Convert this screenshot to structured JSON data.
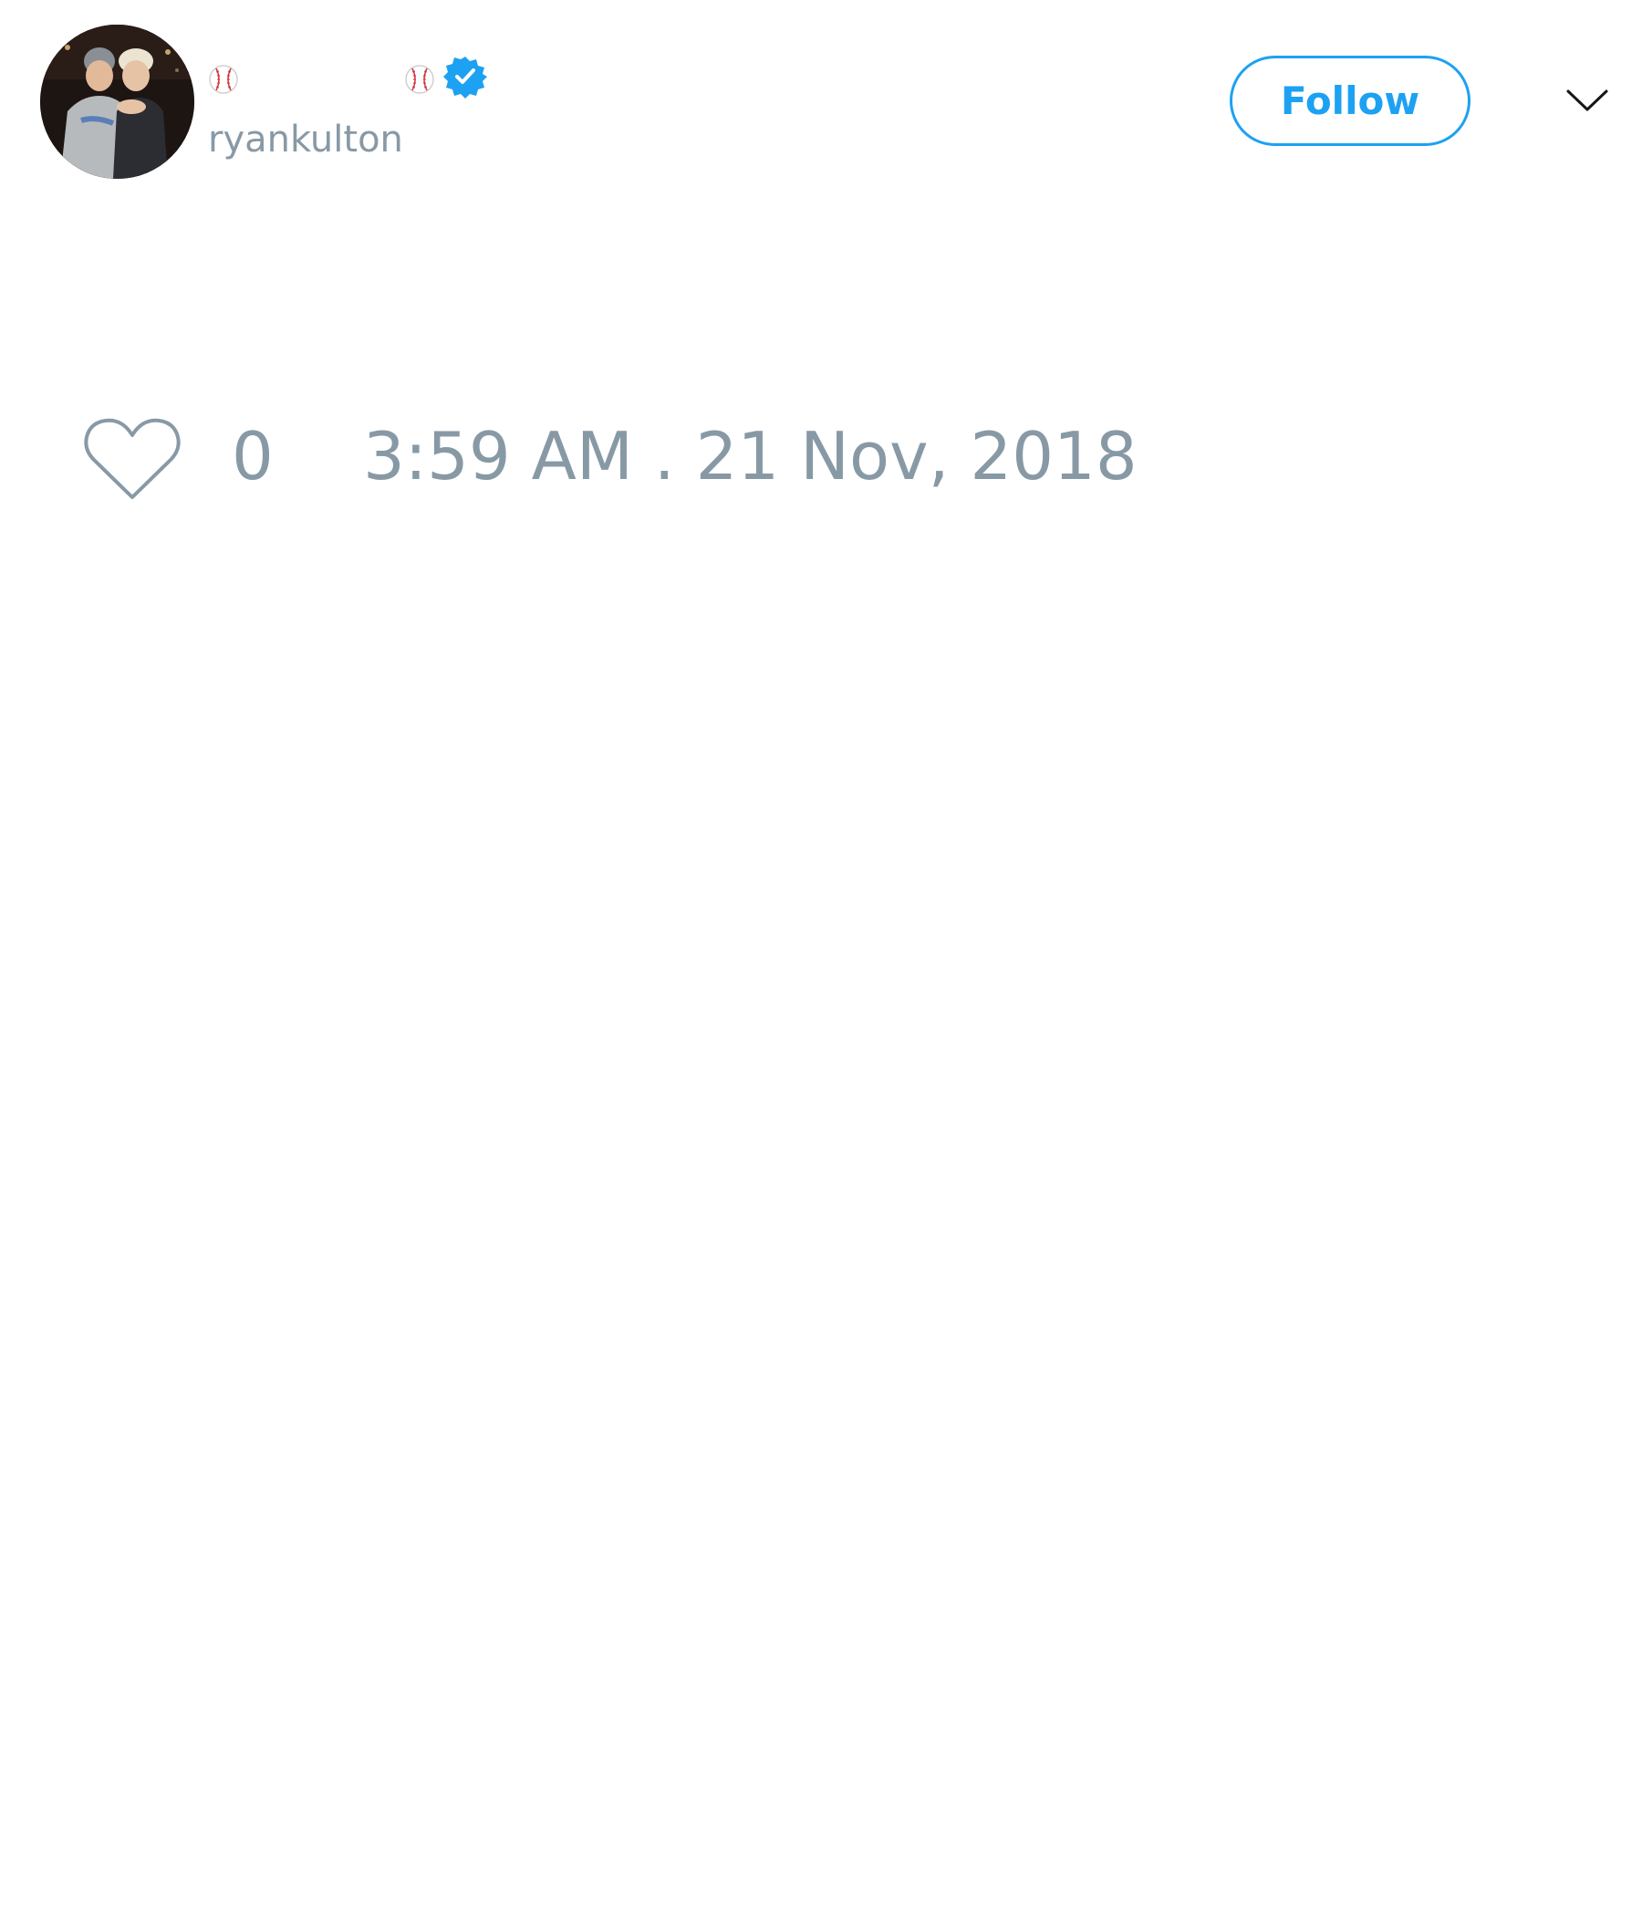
{
  "tweet": {
    "author": {
      "display_name": "",
      "name_emoji_left": "baseball-emoji",
      "name_emoji_right": "baseball-emoji",
      "verified": true,
      "handle": "ryankulton"
    },
    "follow_button_label": "Follow",
    "menu_icon": "chevron-down-icon",
    "actions": {
      "like_icon": "heart-icon",
      "like_count": "0",
      "timestamp": "3:59 AM . 21 Nov, 2018"
    }
  },
  "colors": {
    "accent": "#1da1f2",
    "muted_text": "#8899a6",
    "background": "#ffffff"
  }
}
